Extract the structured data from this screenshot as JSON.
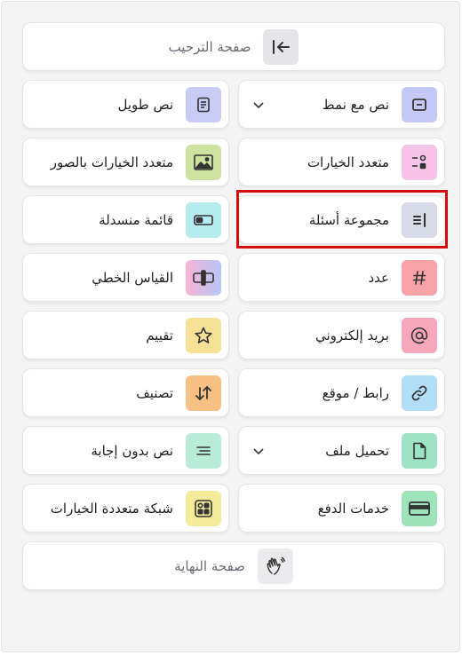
{
  "welcome": {
    "label": "صفحة الترحيب",
    "icon": "collapse-left-arrow-icon"
  },
  "end_page": {
    "label": "صفحة النهاية",
    "icon": "waving-hand-icon"
  },
  "blocks": [
    {
      "id": "styled-text",
      "label": "نص مع نمط",
      "icon": "text-box-icon",
      "color": "#c3c8f5",
      "has_dropdown": true
    },
    {
      "id": "long-text",
      "label": "نص طويل",
      "icon": "document-lines-icon",
      "color": "#c8ccf5"
    },
    {
      "id": "multiple-choice",
      "label": "متعدد الخيارات",
      "icon": "choice-list-icon",
      "color": "#f5c4e6"
    },
    {
      "id": "picture-choice",
      "label": "متعدد الخيارات بالصور",
      "icon": "image-icon",
      "color": "#cfe3a0"
    },
    {
      "id": "question-group",
      "label": "مجموعة أسئلة",
      "icon": "group-list-icon",
      "color": "#d7dbe6"
    },
    {
      "id": "dropdown",
      "label": "قائمة منسدلة",
      "icon": "dropdown-select-icon",
      "color": "#b7ecee"
    },
    {
      "id": "number",
      "label": "عدد",
      "icon": "hash-icon",
      "color": "#f7a3a8"
    },
    {
      "id": "linear-scale",
      "label": "القياس الخطي",
      "icon": "linear-scale-icon",
      "color": "#cfc2f6"
    },
    {
      "id": "email",
      "label": "بريد إلكتروني",
      "icon": "at-sign-icon",
      "color": "#f6a7b9"
    },
    {
      "id": "rating",
      "label": "تقييم",
      "icon": "star-icon",
      "color": "#f7e197"
    },
    {
      "id": "website",
      "label": "رابط / موقع",
      "icon": "link-icon",
      "color": "#b3def7"
    },
    {
      "id": "ranking",
      "label": "تصنيف",
      "icon": "sort-arrows-icon",
      "color": "#f7c085"
    },
    {
      "id": "file-upload",
      "label": "تحميل ملف",
      "icon": "file-icon",
      "color": "#9fe3c7",
      "has_dropdown": true
    },
    {
      "id": "statement",
      "label": "نص بدون إجابة",
      "icon": "text-lines-icon",
      "color": "#b9ecd8"
    },
    {
      "id": "payment",
      "label": "خدمات الدفع",
      "icon": "credit-card-icon",
      "color": "#9fe3ba"
    },
    {
      "id": "matrix",
      "label": "شبكة متعددة الخيارات",
      "icon": "grid-choice-icon",
      "color": "#f4ec9a"
    }
  ],
  "colors": {
    "highlight": "#d40c0c",
    "wide_icon_bg": "#ebebee"
  }
}
